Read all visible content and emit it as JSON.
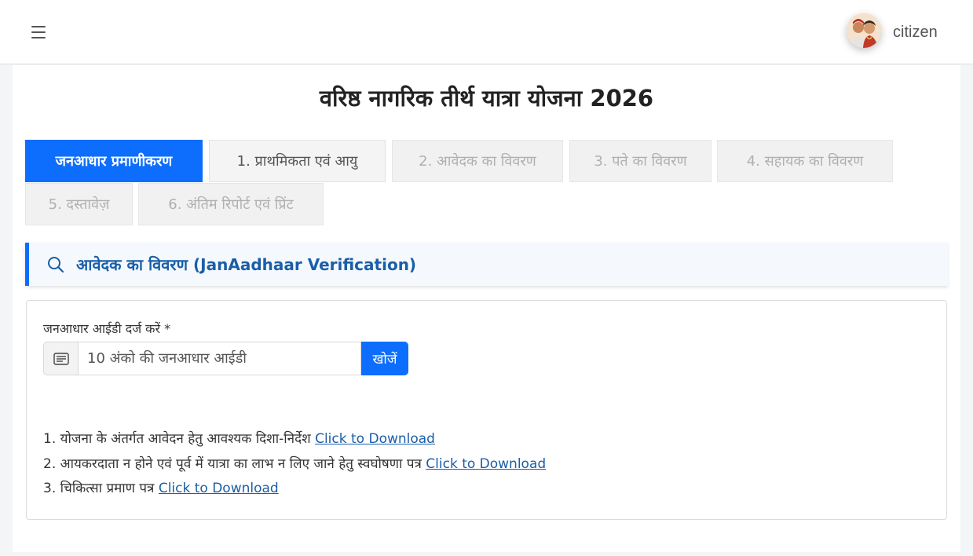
{
  "header": {
    "menu_icon": "hamburger-menu-icon",
    "username": "citizen",
    "avatar_icon": "user-avatar"
  },
  "page": {
    "title": "वरिष्ठ नागरिक तीर्थ यात्रा योजना 2026"
  },
  "tabs": [
    {
      "label": "जनआधार प्रमाणीकरण",
      "state": "active"
    },
    {
      "label": "1. प्राथमिकता एवं आयु",
      "state": "enabled"
    },
    {
      "label": "2. आवेदक का विवरण",
      "state": "disabled"
    },
    {
      "label": "3. पते का विवरण",
      "state": "disabled"
    },
    {
      "label": "4. सहायक का विवरण",
      "state": "disabled"
    },
    {
      "label": "5. दस्तावेज़",
      "state": "disabled"
    },
    {
      "label": "6. अंतिम रिपोर्ट एवं प्रिंट",
      "state": "disabled"
    }
  ],
  "section": {
    "icon": "search-icon",
    "title": "आवेदक का विवरण (JanAadhaar Verification)"
  },
  "form": {
    "label": "जनआधार आईडी दर्ज करें *",
    "input_icon": "id-card-icon",
    "input_placeholder": "10 अंको की जनआधार आईडी",
    "input_value": "",
    "search_button": "खोजें"
  },
  "notes": [
    {
      "text": "1. योजना के अंतर्गत आवेदन हेतु आवश्यक दिशा-निर्देश",
      "link": "Click to Download"
    },
    {
      "text": "2. आयकरदाता न होने एवं पूर्व में यात्रा का लाभ न लिए जाने हेतु स्वघोषणा पत्र",
      "link": "Click to Download"
    },
    {
      "text": "3. चिकित्सा प्रमाण पत्र",
      "link": "Click to Download"
    }
  ],
  "colors": {
    "primary": "#0d6efd",
    "section_title": "#1a5ea8",
    "section_bg": "#f5f9fd",
    "disabled_tab_text": "#b0b0b0"
  }
}
